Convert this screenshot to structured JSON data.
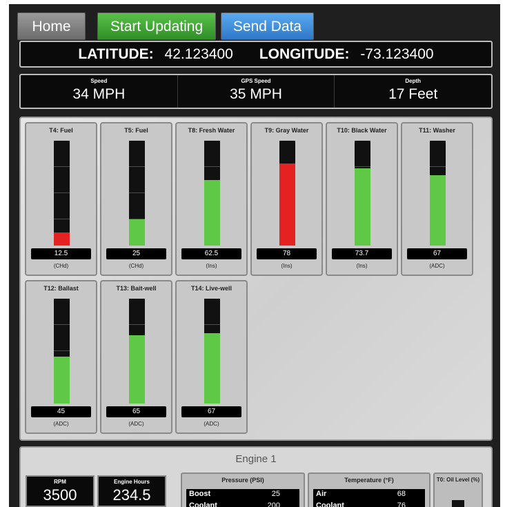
{
  "toolbar": {
    "home_label": "Home",
    "start_label": "Start Updating",
    "send_label": "Send Data"
  },
  "location": {
    "lat_label": "LATITUDE:",
    "lat_value": "42.123400",
    "lon_label": "LONGITUDE:",
    "lon_value": "-73.123400"
  },
  "speeds": [
    {
      "label": "Speed",
      "value": "34 MPH"
    },
    {
      "label": "GPS Speed",
      "value": "35 MPH"
    },
    {
      "label": "Depth",
      "value": "17 Feet"
    }
  ],
  "tanks": [
    {
      "name": "T4: Fuel",
      "reading": "12.5",
      "unit": "(CHd)",
      "level": 0.125,
      "color": "#e52222"
    },
    {
      "name": "T5: Fuel",
      "reading": "25",
      "unit": "(CHd)",
      "level": 0.25,
      "color": "#5fc846"
    },
    {
      "name": "T8: Fresh Water",
      "reading": "62.5",
      "unit": "(Ins)",
      "level": 0.625,
      "color": "#5fc846"
    },
    {
      "name": "T9: Gray Water",
      "reading": "78",
      "unit": "(Ins)",
      "level": 0.78,
      "color": "#e52222"
    },
    {
      "name": "T10: Black Water",
      "reading": "73.7",
      "unit": "(Ins)",
      "level": 0.737,
      "color": "#5fc846"
    },
    {
      "name": "T11: Washer",
      "reading": "67",
      "unit": "(ADC)",
      "level": 0.67,
      "color": "#5fc846"
    },
    {
      "name": "T12: Ballast",
      "reading": "45",
      "unit": "(ADC)",
      "level": 0.45,
      "color": "#5fc846"
    },
    {
      "name": "T13: Bait-well",
      "reading": "65",
      "unit": "(ADC)",
      "level": 0.65,
      "color": "#5fc846"
    },
    {
      "name": "T14: Live-well",
      "reading": "67",
      "unit": "(ADC)",
      "level": 0.67,
      "color": "#5fc846"
    }
  ],
  "engine": {
    "title": "Engine 1",
    "rpm_label": "RPM",
    "rpm_value": "3500",
    "hours_label": "Engine Hours",
    "hours_value": "234.5",
    "pressure": {
      "title": "Pressure (PSI)",
      "rows": [
        {
          "name": "Boost",
          "value": "25"
        },
        {
          "name": "Coolant",
          "value": "200"
        }
      ]
    },
    "temperature": {
      "title": "Temperature (°F)",
      "rows": [
        {
          "name": "Air",
          "value": "68"
        },
        {
          "name": "Coolant",
          "value": "76"
        }
      ]
    },
    "oil_title": "T0: Oil Level (%)"
  }
}
